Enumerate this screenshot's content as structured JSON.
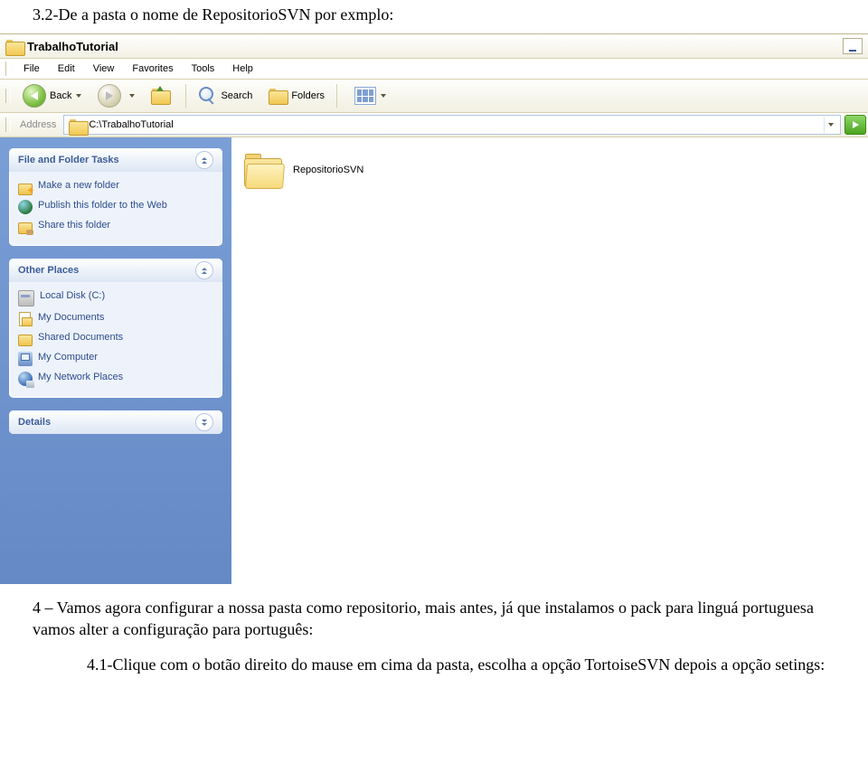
{
  "doc": {
    "caption": "3.2-De a pasta o nome de RepositorioSVN por exmplo:",
    "para1": "4 – Vamos agora configurar a nossa pasta como repositorio, mais antes, já que instalamos o pack para linguá portuguesa vamos alter a configuração para português:",
    "para2": "4.1-Clique com o botão direito do mause em cima da pasta, escolha a opção TortoiseSVN depois a opção setings:"
  },
  "window": {
    "title": "TrabalhoTutorial",
    "menu": [
      "File",
      "Edit",
      "View",
      "Favorites",
      "Tools",
      "Help"
    ],
    "toolbar": {
      "back": "Back",
      "search": "Search",
      "folders": "Folders"
    },
    "address": {
      "label": "Address",
      "value": "C:\\TrabalhoTutorial"
    },
    "sidebar": {
      "tasks": {
        "title": "File and Folder Tasks",
        "items": [
          {
            "icon": "nf",
            "label": "Make a new folder"
          },
          {
            "icon": "pub",
            "label": "Publish this folder to the Web"
          },
          {
            "icon": "shr",
            "label": "Share this folder"
          }
        ]
      },
      "places": {
        "title": "Other Places",
        "items": [
          {
            "icon": "disk",
            "label": "Local Disk (C:)"
          },
          {
            "icon": "docs",
            "label": "My Documents"
          },
          {
            "icon": "sf",
            "label": "Shared Documents"
          },
          {
            "icon": "comp",
            "label": "My Computer"
          },
          {
            "icon": "net",
            "label": "My Network Places"
          }
        ]
      },
      "details": {
        "title": "Details"
      }
    },
    "content": {
      "folder_name": "RepositorioSVN"
    }
  }
}
